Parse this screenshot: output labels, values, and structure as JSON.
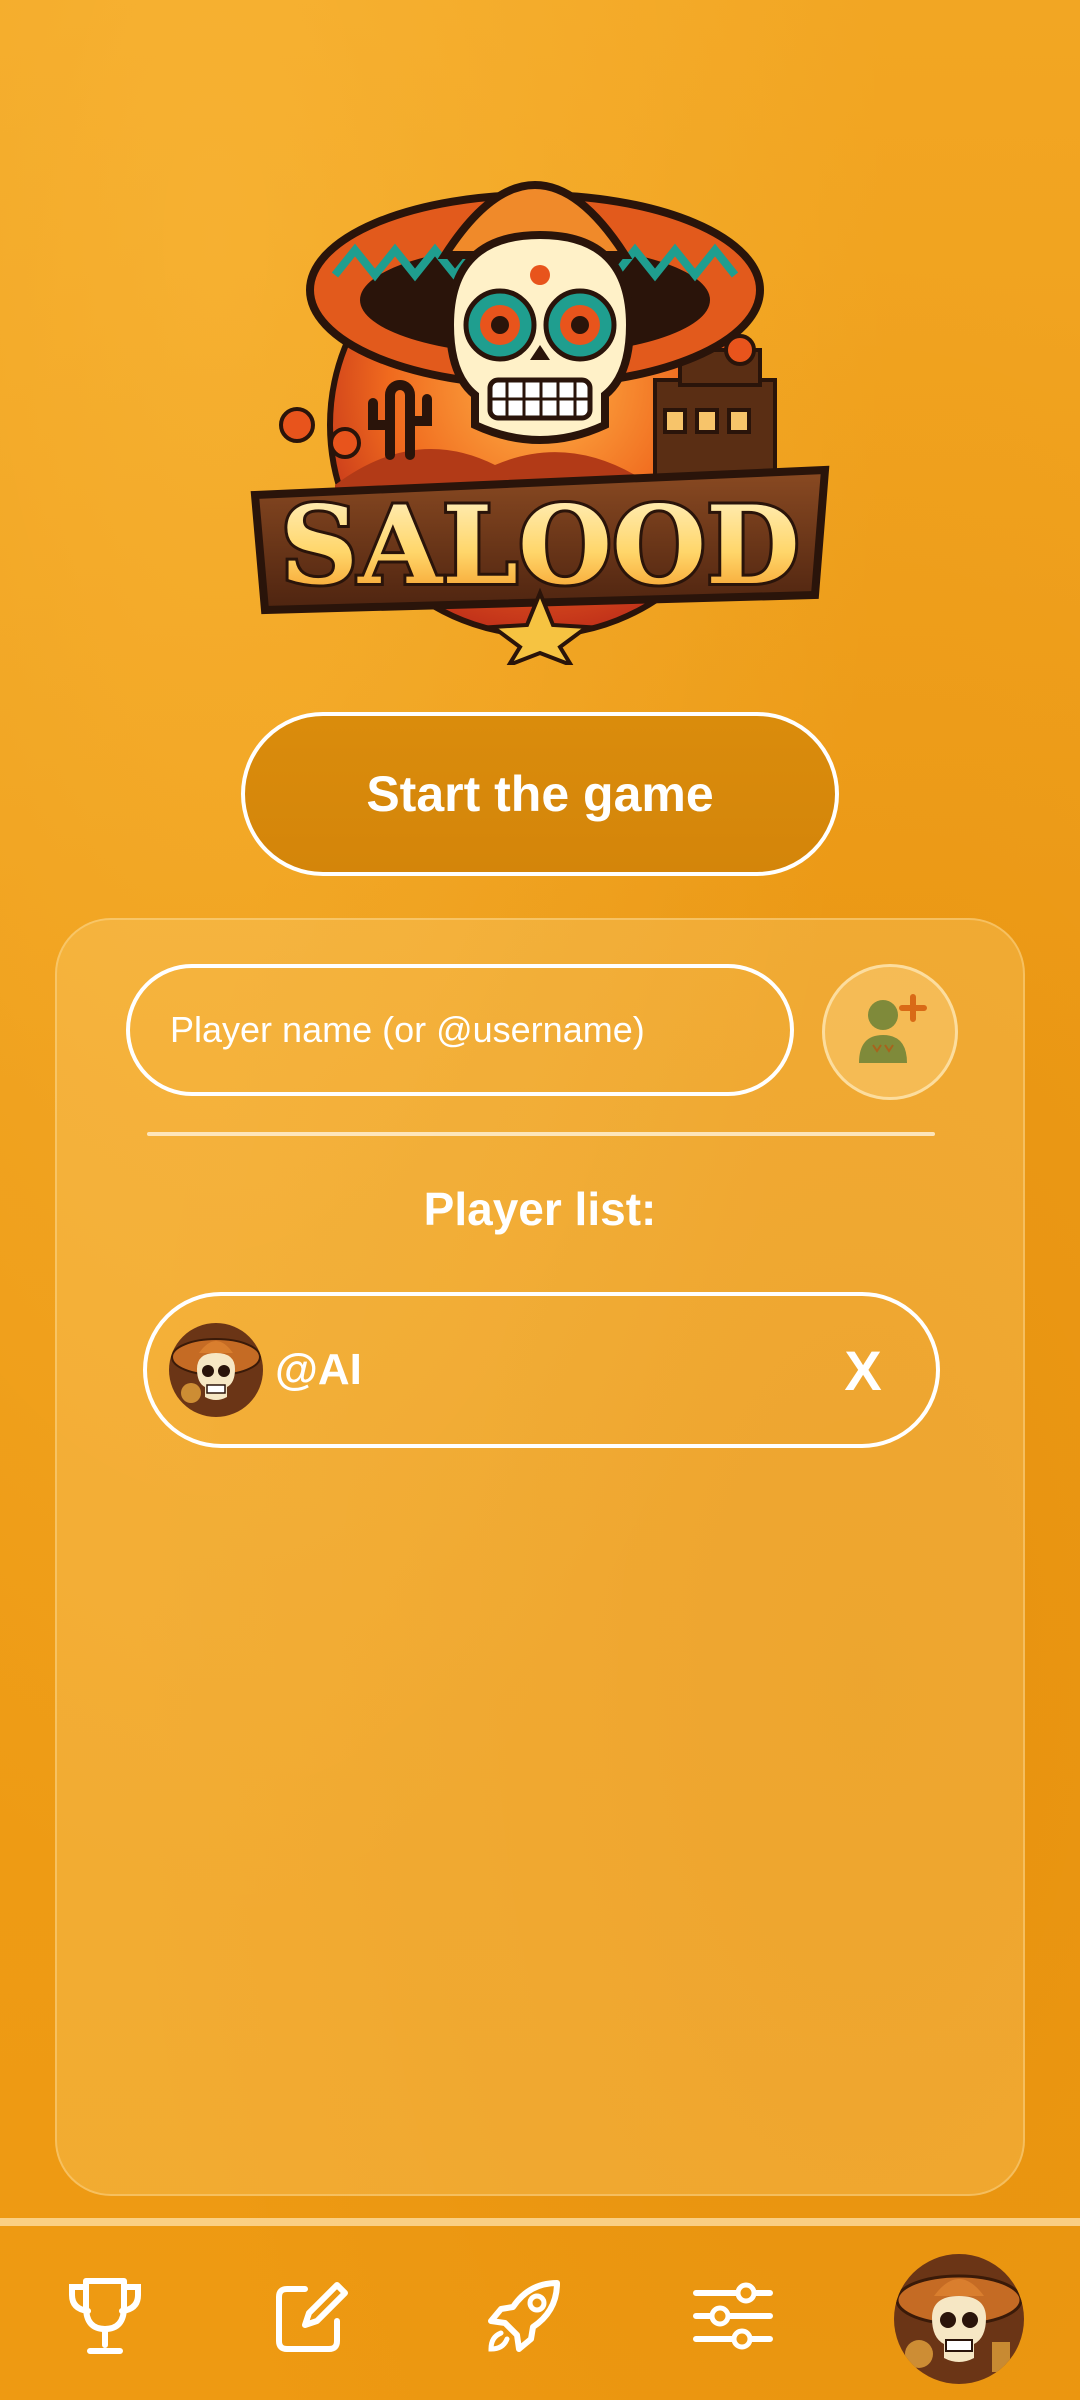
{
  "logo": {
    "word": "SALOOD"
  },
  "start_button": {
    "label": "Start the game"
  },
  "player_form": {
    "name_placeholder": "Player name (or @username)",
    "name_value": "",
    "add_icon": "add-person-icon"
  },
  "player_list": {
    "title": "Player list:",
    "players": [
      {
        "name": "@AI",
        "remove_label": "X"
      }
    ]
  },
  "nav": {
    "items": [
      {
        "icon": "trophy-icon"
      },
      {
        "icon": "edit-icon"
      },
      {
        "icon": "rocket-icon"
      },
      {
        "icon": "sliders-icon"
      },
      {
        "icon": "profile-avatar"
      }
    ]
  },
  "colors": {
    "background": "#EE9C17",
    "button": "#D4850A",
    "text": "#FFFFFF"
  }
}
